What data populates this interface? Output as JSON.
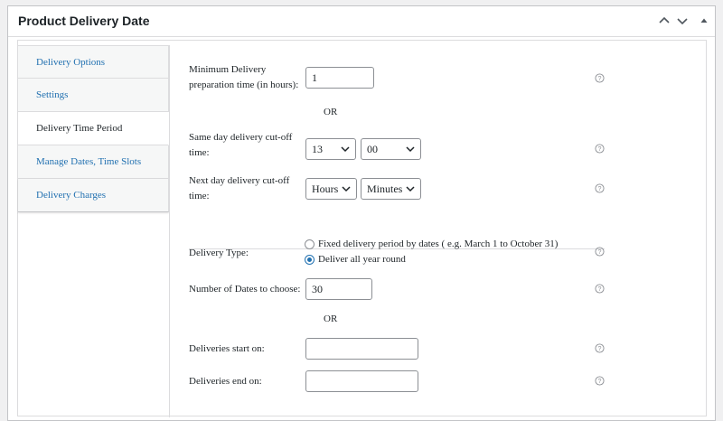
{
  "postbox": {
    "title": "Product Delivery Date"
  },
  "tabs": [
    {
      "label": "Delivery Options"
    },
    {
      "label": "Settings"
    },
    {
      "label": "Delivery Time Period"
    },
    {
      "label": "Manage Dates, Time Slots"
    },
    {
      "label": "Delivery Charges"
    }
  ],
  "fields": {
    "min_prep": {
      "label_line1": "Minimum Delivery",
      "label_line2": "preparation time (in hours):",
      "value": "1"
    },
    "or1": "OR",
    "same_day": {
      "label_line1": "Same day delivery cut-off",
      "label_line2": "time:",
      "hour": "13",
      "minute": "00"
    },
    "next_day": {
      "label_line1": "Next day delivery cut-off",
      "label_line2": "time:",
      "hour": "Hours",
      "minute": "Minutes"
    },
    "delivery_type": {
      "label": "Delivery Type:",
      "options": [
        {
          "label": "Fixed delivery period by dates ( e.g. March 1 to October 31)",
          "checked": false
        },
        {
          "label": "Deliver all year round",
          "checked": true
        }
      ]
    },
    "num_dates": {
      "label": "Number of Dates to choose:",
      "value": "30"
    },
    "or2": "OR",
    "start_on": {
      "label": "Deliveries start on:",
      "value": ""
    },
    "end_on": {
      "label": "Deliveries end on:",
      "value": ""
    }
  },
  "icons": {
    "help": "help-circle-icon",
    "chevron": "chevron-down-icon",
    "up": "chevron-up-icon",
    "toggle": "triangle-up-icon"
  },
  "colors": {
    "link": "#2271b1",
    "border": "#dcdcde",
    "input_border": "#8c8f94",
    "background": "#f0f0f1"
  }
}
